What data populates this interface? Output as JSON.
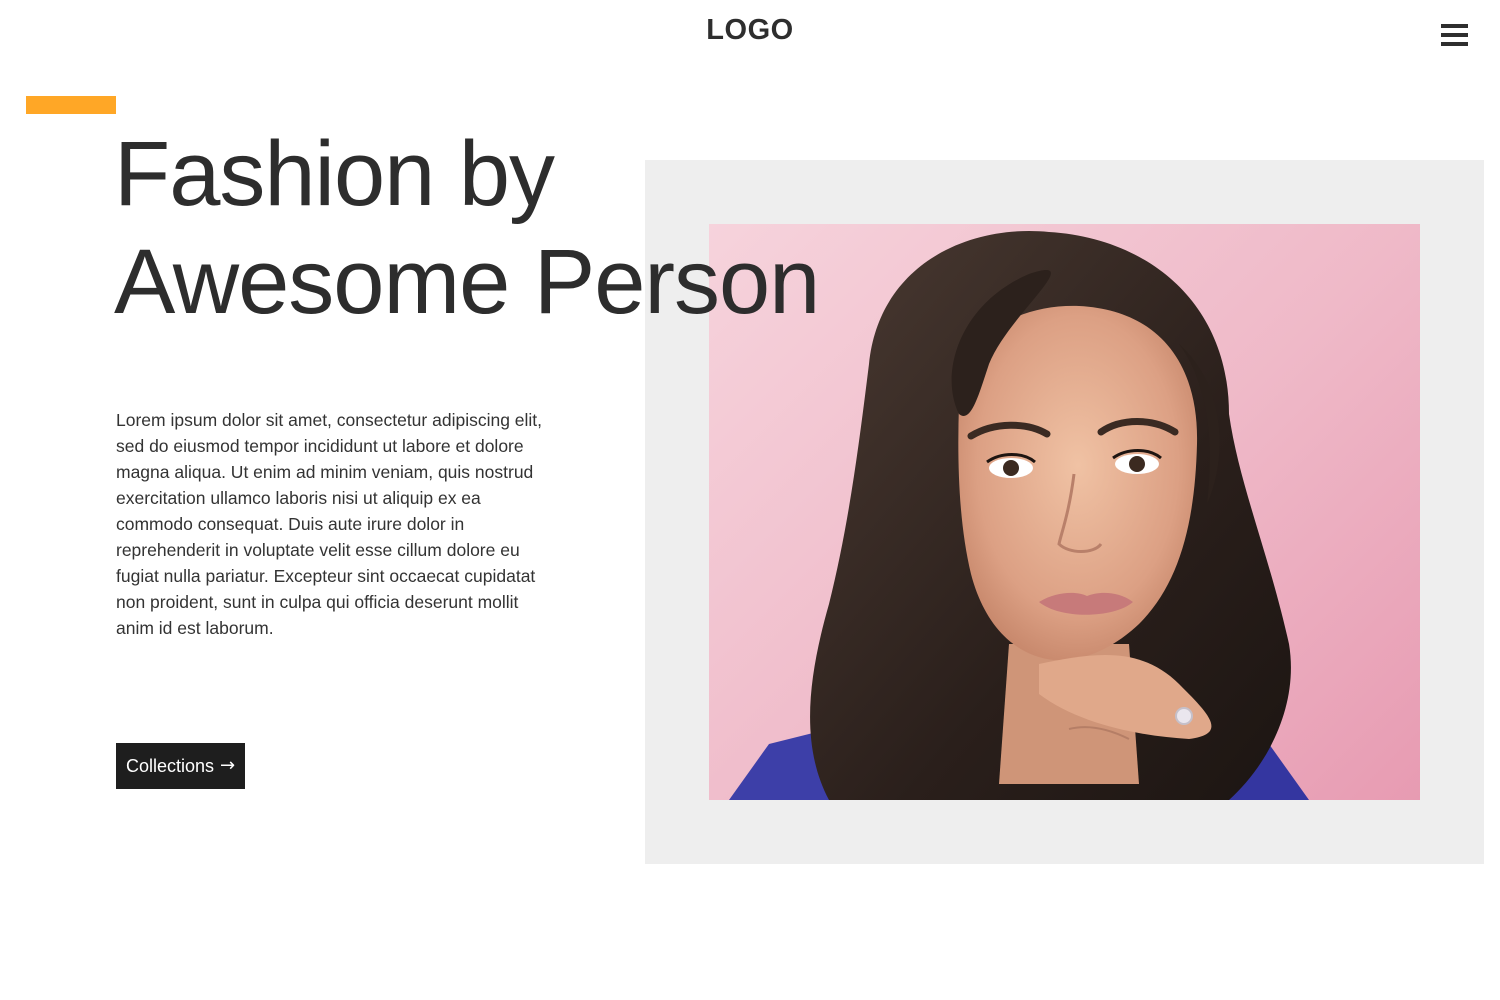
{
  "header": {
    "logo_text": "LOGO",
    "menu_icon": "hamburger-menu-icon"
  },
  "colors": {
    "accent": "#ffa726",
    "button_bg": "#1e1e1e",
    "frame_bg": "#eeeeee",
    "text": "#2d2d2d"
  },
  "hero": {
    "title_line1": "Fashion by",
    "title_line2": "Awesome Person",
    "description": "Lorem ipsum dolor sit amet, consectetur adipiscing elit, sed do eiusmod tempor incididunt ut labore et dolore magna aliqua. Ut enim ad minim veniam, quis nostrud exercitation ullamco laboris nisi ut aliquip ex ea commodo consequat. Duis aute irure dolor in reprehenderit in voluptate velit esse cillum dolore eu fugiat nulla pariatur. Excepteur sint occaecat cupidatat non proident, sunt in culpa qui officia deserunt mollit anim id est laborum.",
    "cta_label": "Collections",
    "cta_arrow": "→"
  },
  "image": {
    "subject": "portrait-photo",
    "background": "pink"
  }
}
